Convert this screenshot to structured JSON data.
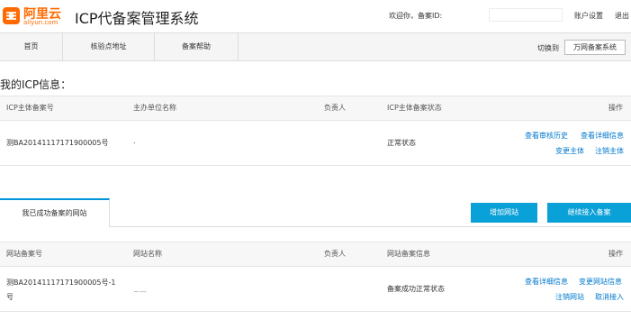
{
  "header": {
    "logo_cn": "阿里云",
    "logo_en": "aliyun.com",
    "title": "ICP代备案管理系统",
    "welcome": "欢迎你，备案ID:",
    "account_settings": "账户设置",
    "logout": "退出"
  },
  "nav": {
    "home": "首页",
    "verify_address": "核验点地址",
    "help": "备案帮助",
    "switch_label": "切换到",
    "switch_button": "万网备案系统"
  },
  "icp": {
    "section_title": "我的ICP信息：",
    "columns": [
      "ICP主体备案号",
      "主办单位名称",
      "负责人",
      "ICP主体备案状态",
      "操作"
    ],
    "row": {
      "record_no": "测BA20141117171900005号",
      "org_name": ".",
      "owner": "",
      "status": "正常状态",
      "actions": [
        "查看审核历史",
        "查看详细信息",
        "变更主体",
        "注销主体"
      ]
    }
  },
  "sites": {
    "tab_label": "我已成功备案的网站",
    "add_button": "增加网站",
    "continue_button": "继续接入备案",
    "columns": [
      "网站备案号",
      "网站名称",
      "负责人",
      "网站备案信息",
      "操作"
    ],
    "row": {
      "record_no_line1": "测BA20141117171900005号-1",
      "record_no_line2": "号",
      "site_name": "~—",
      "owner": "",
      "info": "备案成功正常状态",
      "actions": [
        "查看详细信息",
        "变更网站信息",
        "注销网站",
        "取消接入"
      ]
    }
  }
}
